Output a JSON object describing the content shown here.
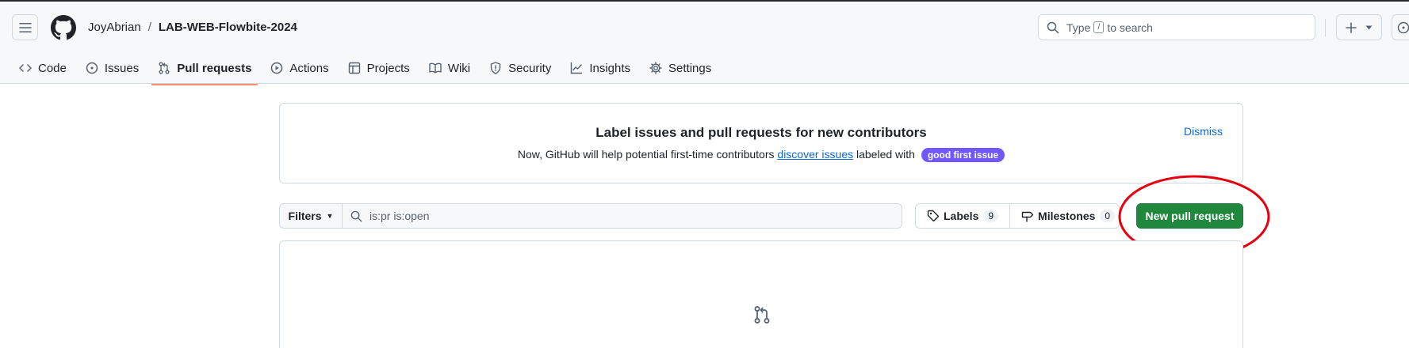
{
  "header": {
    "owner": "JoyAbrian",
    "separator": "/",
    "repo": "LAB-WEB-Flowbite-2024",
    "search": {
      "prefix": "Type",
      "key": "/",
      "suffix": "to search"
    }
  },
  "tabs": [
    {
      "label": "Code",
      "icon": "code-icon",
      "selected": false
    },
    {
      "label": "Issues",
      "icon": "issue-opened-icon",
      "selected": false
    },
    {
      "label": "Pull requests",
      "icon": "git-pull-request-icon",
      "selected": true
    },
    {
      "label": "Actions",
      "icon": "play-icon",
      "selected": false
    },
    {
      "label": "Projects",
      "icon": "table-icon",
      "selected": false
    },
    {
      "label": "Wiki",
      "icon": "book-icon",
      "selected": false
    },
    {
      "label": "Security",
      "icon": "shield-icon",
      "selected": false
    },
    {
      "label": "Insights",
      "icon": "graph-icon",
      "selected": false
    },
    {
      "label": "Settings",
      "icon": "gear-icon",
      "selected": false
    }
  ],
  "banner": {
    "title": "Label issues and pull requests for new contributors",
    "text_before": "Now, GitHub will help potential first-time contributors ",
    "link": "discover issues",
    "text_after": " labeled with ",
    "label": "good first issue",
    "dismiss": "Dismiss"
  },
  "filters": {
    "button": "Filters",
    "query": "is:pr is:open"
  },
  "labels": {
    "label": "Labels",
    "count": "9"
  },
  "milestones": {
    "label": "Milestones",
    "count": "0"
  },
  "new_pr_button": "New pull request",
  "colors": {
    "primary_button": "#1f883d",
    "tab_underline": "#fd8c73",
    "label_pill": "#7057ff",
    "annotation": "#e3000f"
  }
}
